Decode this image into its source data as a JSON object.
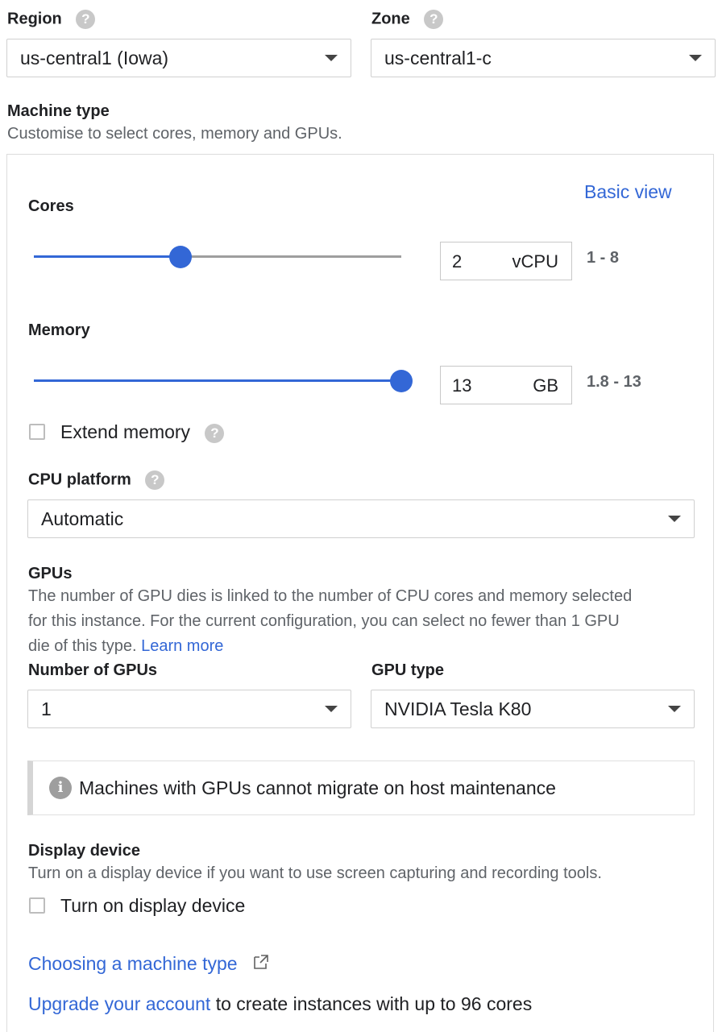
{
  "region": {
    "label": "Region",
    "value": "us-central1 (Iowa)"
  },
  "zone": {
    "label": "Zone",
    "value": "us-central1-c"
  },
  "machine_type": {
    "title": "Machine type",
    "subtitle": "Customise to select cores, memory and GPUs.",
    "basic_view_link": "Basic view",
    "cores": {
      "label": "Cores",
      "value": "2",
      "unit": "vCPU",
      "range": "1 - 8",
      "slider_fraction": 0.4
    },
    "memory": {
      "label": "Memory",
      "value": "13",
      "unit": "GB",
      "range": "1.8 - 13",
      "slider_fraction": 1.0
    },
    "extend_memory": {
      "label": "Extend memory",
      "checked": false
    },
    "cpu_platform": {
      "label": "CPU platform",
      "value": "Automatic"
    },
    "gpus": {
      "title": "GPUs",
      "description_line1": "The number of GPU dies is linked to the number of CPU cores and memory selected",
      "description_line2": "for this instance. For the current configuration, you can select no fewer than 1 GPU",
      "description_line3": "die of this type.",
      "learn_more": "Learn more",
      "count_label": "Number of GPUs",
      "count_value": "1",
      "type_label": "GPU type",
      "type_value": "NVIDIA Tesla K80"
    },
    "info_message": "Machines with GPUs cannot migrate on host maintenance",
    "display_device": {
      "title": "Display device",
      "description": "Turn on a display device if you want to use screen capturing and recording tools.",
      "checkbox_label": "Turn on display device",
      "checked": false
    },
    "choosing_link": "Choosing a machine type",
    "upgrade_link": "Upgrade your account",
    "upgrade_text": " to create instances with up to 96 cores"
  },
  "colors": {
    "accent": "#3367d6",
    "track_inactive": "#9e9e9e",
    "muted_text": "#5f6368"
  },
  "icons": [
    "help-icon",
    "dropdown-caret-icon",
    "info-icon",
    "external-link-icon"
  ]
}
